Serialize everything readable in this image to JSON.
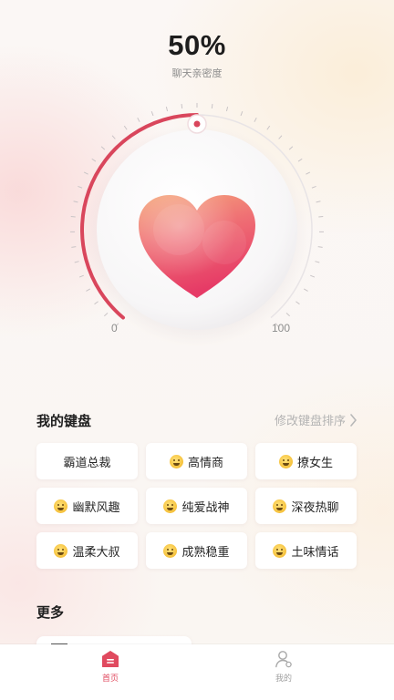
{
  "intimacy": {
    "percent_text": "50%",
    "label": "聊天亲密度",
    "value": 0.5,
    "scale_min": "0",
    "scale_max": "100"
  },
  "keyboard_section": {
    "title": "我的键盘",
    "sort_link": "修改键盘排序",
    "items": [
      {
        "label": "霸道总裁",
        "icon": ""
      },
      {
        "label": "高情商",
        "icon": "grin-emoji-icon"
      },
      {
        "label": "撩女生",
        "icon": "grin-emoji-icon"
      },
      {
        "label": "幽默风趣",
        "icon": "grin-emoji-icon"
      },
      {
        "label": "纯爱战神",
        "icon": "grin-emoji-icon"
      },
      {
        "label": "深夜热聊",
        "icon": "grin-emoji-icon"
      },
      {
        "label": "温柔大叔",
        "icon": "grin-emoji-icon"
      },
      {
        "label": "成熟稳重",
        "icon": "grin-emoji-icon"
      },
      {
        "label": "土味情话",
        "icon": "grin-emoji-icon"
      }
    ]
  },
  "more_section": {
    "title": "更多"
  },
  "tabbar": {
    "home": "首页",
    "mine": "我的"
  },
  "colors": {
    "accent": "#d9465c",
    "heart_top": "#f4a07a",
    "heart_bottom": "#e8456a"
  }
}
